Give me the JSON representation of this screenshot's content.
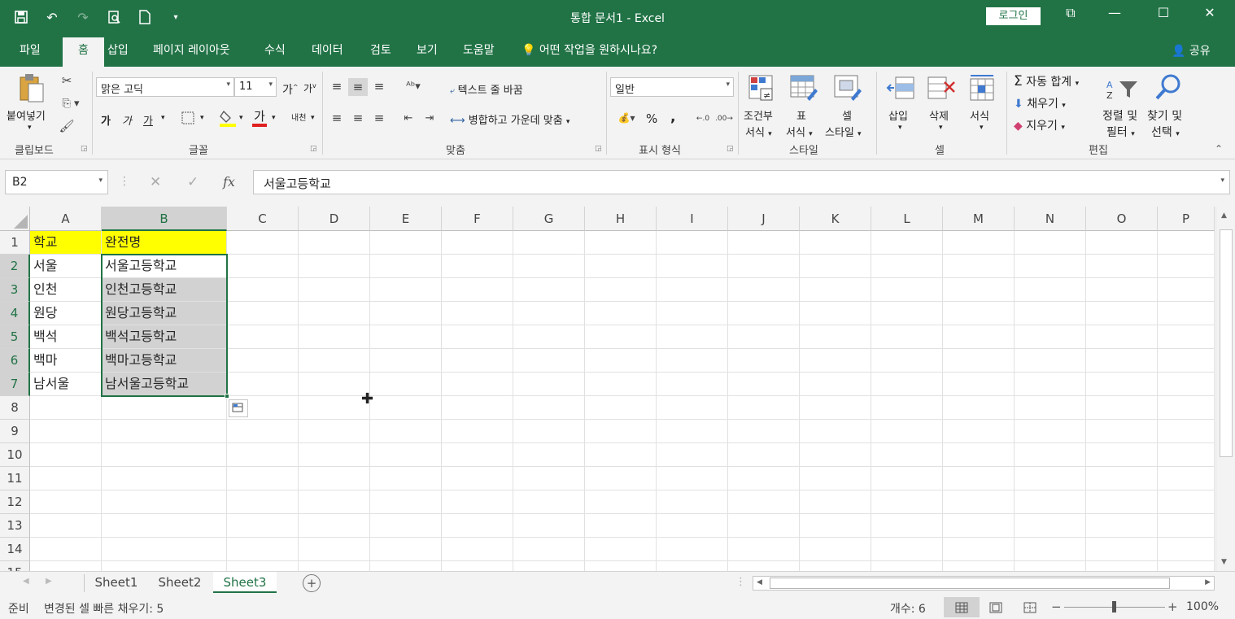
{
  "window": {
    "title": "통합 문서1  -  Excel",
    "login_label": "로그인",
    "quick_access_icons": [
      "save-icon",
      "undo-icon",
      "redo-icon",
      "print-preview-icon",
      "new-file-icon",
      "customize-icon"
    ]
  },
  "menu": {
    "tabs": [
      "파일",
      "홈",
      "삽입",
      "페이지 레이아웃",
      "수식",
      "데이터",
      "검토",
      "보기",
      "도움말"
    ],
    "active_tab": "홈",
    "tell_me": "어떤 작업을 원하시나요?",
    "share": "공유"
  },
  "ribbon": {
    "clipboard": {
      "paste": "붙여넣기",
      "label": "클립보드"
    },
    "font": {
      "name": "맑은 고딕",
      "size": "11",
      "grow": "가",
      "shrink": "가",
      "bold": "가",
      "italic": "가",
      "underline": "가",
      "color_a": "가",
      "phonetic": "내천",
      "label": "글꼴"
    },
    "alignment": {
      "wrap": "텍스트 줄 바꿈",
      "merge": "병합하고 가운데 맞춤",
      "label": "맞춤"
    },
    "number": {
      "format": "일반",
      "percent": "%",
      "comma": ",",
      "label": "표시 형식"
    },
    "styles": {
      "conditional_1": "조건부",
      "conditional_2": "서식",
      "table_1": "표",
      "table_2": "서식",
      "cell_1": "셀",
      "cell_2": "스타일",
      "label": "스타일"
    },
    "cells": {
      "insert": "삽입",
      "delete": "삭제",
      "format": "서식",
      "label": "셀"
    },
    "editing": {
      "autosum": "자동 합계",
      "fill": "채우기",
      "clear": "지우기",
      "sort_1": "정렬 및",
      "sort_2": "필터",
      "find_1": "찾기 및",
      "find_2": "선택",
      "label": "편집"
    }
  },
  "formula_bar": {
    "name_box": "B2",
    "fx": "fx",
    "content": "서울고등학교"
  },
  "columns": [
    "A",
    "B",
    "C",
    "D",
    "E",
    "F",
    "G",
    "H",
    "I",
    "J",
    "K",
    "L",
    "M",
    "N",
    "O",
    "P"
  ],
  "rows": [
    "1",
    "2",
    "3",
    "4",
    "5",
    "6",
    "7",
    "8",
    "9",
    "10",
    "11",
    "12",
    "13",
    "14",
    "15"
  ],
  "cells": {
    "A1": "학교",
    "B1": "완전명",
    "A2": "서울",
    "B2": "서울고등학교",
    "A3": "인천",
    "B3": "인천고등학교",
    "A4": "원당",
    "B4": "원당고등학교",
    "A5": "백석",
    "B5": "백석고등학교",
    "A6": "백마",
    "B6": "백마고등학교",
    "A7": "남서울",
    "B7": "남서울고등학교"
  },
  "highlight_color": "#ffff00",
  "selection_color": "#217346",
  "sheets": [
    "Sheet1",
    "Sheet2",
    "Sheet3"
  ],
  "active_sheet": "Sheet3",
  "status": {
    "ready": "준비",
    "flash_fill": "변경된 셀 빠른 채우기: 5",
    "count": "개수: 6",
    "zoom": "100%"
  }
}
